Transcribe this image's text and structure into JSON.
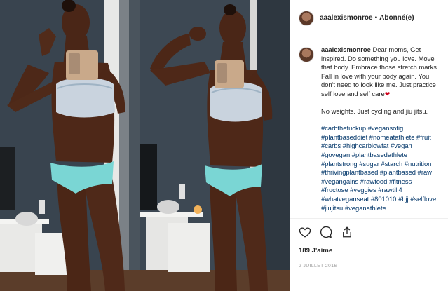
{
  "post": {
    "username": "aaalexismonroe",
    "separator": "•",
    "follow_status": "Abonné(e)"
  },
  "caption": {
    "username": "aaalexismonroe",
    "text": "Dear moms, Get inspired. Do something you love. Move that body. Embrace those stretch marks. Fall in love with your body again. You don't need to look like me. Just practice self love and self care",
    "heart_icon": "heart-emoji",
    "line2": "No weights. Just cycling and jiu jitsu.",
    "hashtags": "#carbthefuckup #vegansofig #plantbaseddiet #nomeatathlete #fruit #carbs #highcarblowfat #vegan #govegan #plantbasedathlete #plantstrong #sugar #starch #nutrition #thrivingplantbased #plantbased #raw #vegangains #rawfood #fitness #fructose #veggies #rawtill4 #whatveganseat #801010 #bjj #selflove #jiujitsu #veganathlete"
  },
  "actions": {
    "like_icon": "heart-outline-icon",
    "comment_icon": "comment-bubble-icon",
    "share_icon": "share-upload-icon",
    "likes_text": "189 J'aime",
    "date_text": "2 JUILLET 2016"
  },
  "colors": {
    "hashtag": "#003569",
    "text": "#262626",
    "muted": "#999999",
    "border": "#efefef"
  }
}
